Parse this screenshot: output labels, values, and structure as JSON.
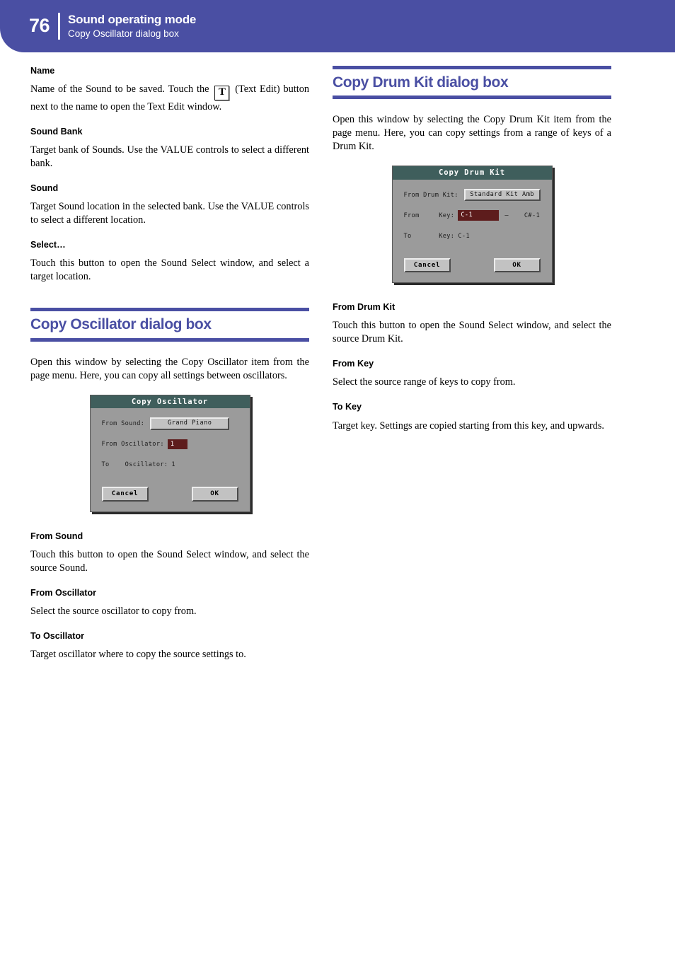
{
  "header": {
    "page_number": "76",
    "title": "Sound operating mode",
    "subtitle": "Copy Oscillator dialog box"
  },
  "colors": {
    "accent": "#4a4fa3",
    "lcd_titlebar": "#3f5e5c",
    "lcd_background": "#9b9b9b",
    "lcd_highlight": "#5d1c1c"
  },
  "left_column": {
    "blocks": [
      {
        "heading": "Name",
        "text_before_icon": "Name of the Sound to be saved. Touch the ",
        "icon_glyph": "T",
        "text_after_icon": " (Text Edit) button next to the name to open the Text Edit window."
      },
      {
        "heading": "Sound Bank",
        "text": "Target bank of Sounds. Use the VALUE controls to select a different bank."
      },
      {
        "heading": "Sound",
        "text": "Target Sound location in the selected bank. Use the VALUE controls to select a different location."
      },
      {
        "heading": "Select…",
        "text": "Touch this button to open the Sound Select window, and select a target location."
      }
    ],
    "section": {
      "title": "Copy Oscillator dialog box",
      "intro": "Open this window by selecting the Copy Oscillator item from the page menu. Here, you can copy all settings between oscillators."
    },
    "dialog": {
      "title": "Copy Oscillator",
      "rows": [
        {
          "label": "From Sound:",
          "value": "Grand Piano",
          "type": "button"
        },
        {
          "label": "From Oscillator:",
          "value": "1",
          "type": "highlight"
        },
        {
          "label": "To    Oscillator:",
          "value": "1",
          "type": "plain"
        }
      ],
      "cancel_label": "Cancel",
      "ok_label": "OK"
    },
    "blocks_after": [
      {
        "heading": "From Sound",
        "text": "Touch this button to open the Sound Select window, and select the source Sound."
      },
      {
        "heading": "From Oscillator",
        "text": "Select the source oscillator to copy from."
      },
      {
        "heading": "To Oscillator",
        "text": "Target oscillator where to copy the source settings to."
      }
    ]
  },
  "right_column": {
    "section": {
      "title": "Copy Drum Kit dialog box",
      "intro": "Open this window by selecting the Copy Drum Kit item from the page menu. Here, you can copy settings from a range of keys of a Drum Kit."
    },
    "dialog": {
      "title": "Copy Drum Kit",
      "rows": [
        {
          "label": "From Drum Kit:",
          "value": "Standard Kit Amb",
          "type": "button"
        },
        {
          "label": "From     Key:",
          "value": "C-1",
          "type": "highlight",
          "separator": "–",
          "extra": "C#-1"
        },
        {
          "label": "To       Key:",
          "value": "C-1",
          "type": "plain"
        }
      ],
      "cancel_label": "Cancel",
      "ok_label": "OK"
    },
    "blocks_after": [
      {
        "heading": "From Drum Kit",
        "text": "Touch this button to open the Sound Select window, and select the source Drum Kit."
      },
      {
        "heading": "From Key",
        "text": "Select the source range of keys to copy from."
      },
      {
        "heading": "To Key",
        "text": "Target key. Settings are copied starting from this key, and upwards."
      }
    ]
  }
}
